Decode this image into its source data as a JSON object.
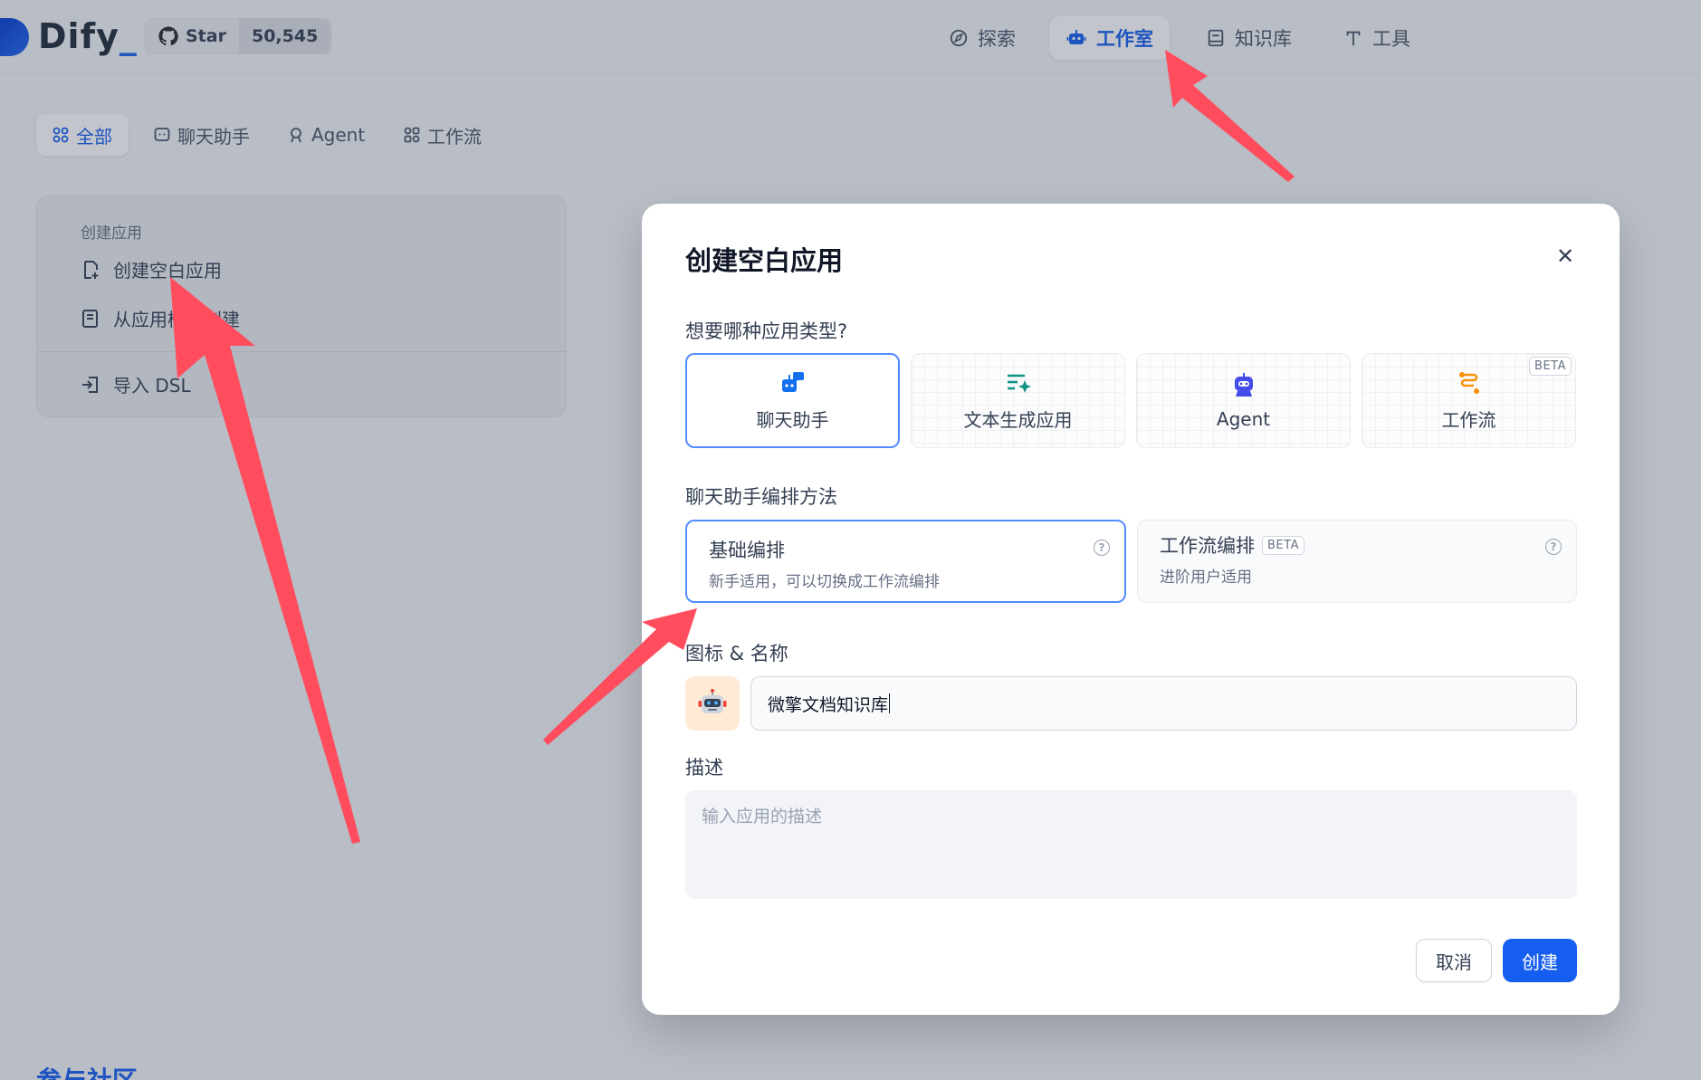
{
  "header": {
    "logo_text": "Dify",
    "logo_suffix": "_",
    "github_label": "Star",
    "github_count": "50,545",
    "nav": [
      {
        "label": "探索",
        "icon": "compass-icon",
        "active": false
      },
      {
        "label": "工作室",
        "icon": "robot-icon",
        "active": true
      },
      {
        "label": "知识库",
        "icon": "book-icon",
        "active": false
      },
      {
        "label": "工具",
        "icon": "hammer-icon",
        "active": false
      }
    ]
  },
  "filters": [
    {
      "label": "全部",
      "active": true
    },
    {
      "label": "聊天助手",
      "active": false
    },
    {
      "label": "Agent",
      "active": false
    },
    {
      "label": "工作流",
      "active": false
    }
  ],
  "create_card": {
    "title": "创建应用",
    "blank": "创建空白应用",
    "from_template": "从应用模板创建",
    "import_dsl": "导入 DSL"
  },
  "community_title": "参与社区",
  "modal": {
    "title": "创建空白应用",
    "type_question": "想要哪种应用类型?",
    "types": [
      {
        "label": "聊天助手",
        "icon": "chat-bot-icon",
        "selected": true
      },
      {
        "label": "文本生成应用",
        "icon": "text-generation-icon",
        "selected": false
      },
      {
        "label": "Agent",
        "icon": "agent-icon",
        "selected": false
      },
      {
        "label": "工作流",
        "icon": "workflow-icon",
        "selected": false,
        "badge": "BETA"
      }
    ],
    "mode_label": "聊天助手编排方法",
    "modes": [
      {
        "title": "基础编排",
        "desc": "新手适用，可以切换成工作流编排",
        "selected": true
      },
      {
        "title": "工作流编排",
        "badge": "BETA",
        "desc": "进阶用户适用",
        "selected": false
      }
    ],
    "name_label": "图标 & 名称",
    "name_value": "微擎文档知识库",
    "desc_label": "描述",
    "desc_placeholder": "输入应用的描述",
    "cancel": "取消",
    "create": "创建"
  },
  "colors": {
    "accent": "#155eef",
    "arrow": "#ff4d5e"
  }
}
